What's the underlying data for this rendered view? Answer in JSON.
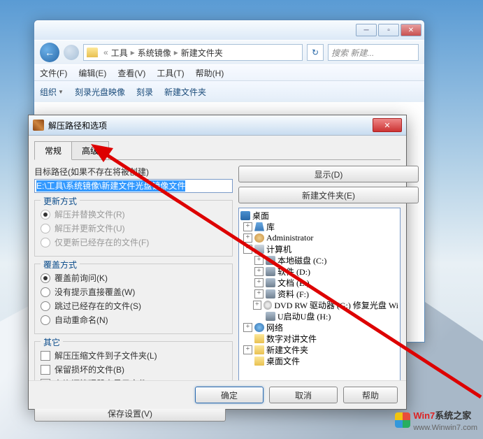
{
  "explorer": {
    "breadcrumb": {
      "sep": "«",
      "p1": "工具",
      "p2": "系统镜像",
      "p3": "新建文件夹"
    },
    "search_placeholder": "搜索 新建...",
    "menu": {
      "file": "文件(F)",
      "edit": "编辑(E)",
      "view": "查看(V)",
      "tools": "工具(T)",
      "help": "帮助(H)"
    },
    "toolbar": {
      "organize": "组织",
      "burn_iso": "刻录光盘映像",
      "burn": "刻录",
      "new_folder": "新建文件夹"
    }
  },
  "dialog": {
    "title": "解压路径和选项",
    "tabs": {
      "general": "常规",
      "advanced": "高级"
    },
    "path_label": "目标路径(如果不存在将被创建)",
    "path_value_prefix": "E:\\工具\\系统镜像\\新建文件",
    "path_value_suffix": "光盘镜像文件",
    "btn_display": "显示(D)",
    "btn_newfolder": "新建文件夹(E)",
    "update": {
      "title": "更新方式",
      "r1": "解压并替换文件(R)",
      "r2": "解压并更新文件(U)",
      "r3": "仅更新已经存在的文件(F)"
    },
    "overwrite": {
      "title": "覆盖方式",
      "r1": "覆盖前询问(K)",
      "r2": "没有提示直接覆盖(W)",
      "r3": "跳过已经存在的文件(S)",
      "r4": "自动重命名(N)"
    },
    "misc": {
      "title": "其它",
      "c1": "解压压缩文件到子文件夹(L)",
      "c2": "保留损坏的文件(B)",
      "c3": "在资源管理器中显示文件(X)"
    },
    "save": "保存设置(V)",
    "ok": "确定",
    "cancel": "取消",
    "help": "帮助",
    "tree": {
      "desktop": "桌面",
      "lib": "库",
      "admin": "Administrator",
      "computer": "计算机",
      "localdisk": "本地磁盘 (C:)",
      "soft": "软件 (D:)",
      "docs": "文档 (E:)",
      "data": "资料 (F:)",
      "dvd": "DVD RW 驱动器 (G:) 修复光盘 Wi",
      "usb": "U启动U盘 (H:)",
      "network": "网络",
      "digi": "数字对讲文件",
      "new": "新建文件夹",
      "deskfiles": "桌面文件"
    }
  },
  "watermark": {
    "brand1": "Win7",
    "brand2": "系统之家",
    "url": "www.Winwin7.com"
  }
}
